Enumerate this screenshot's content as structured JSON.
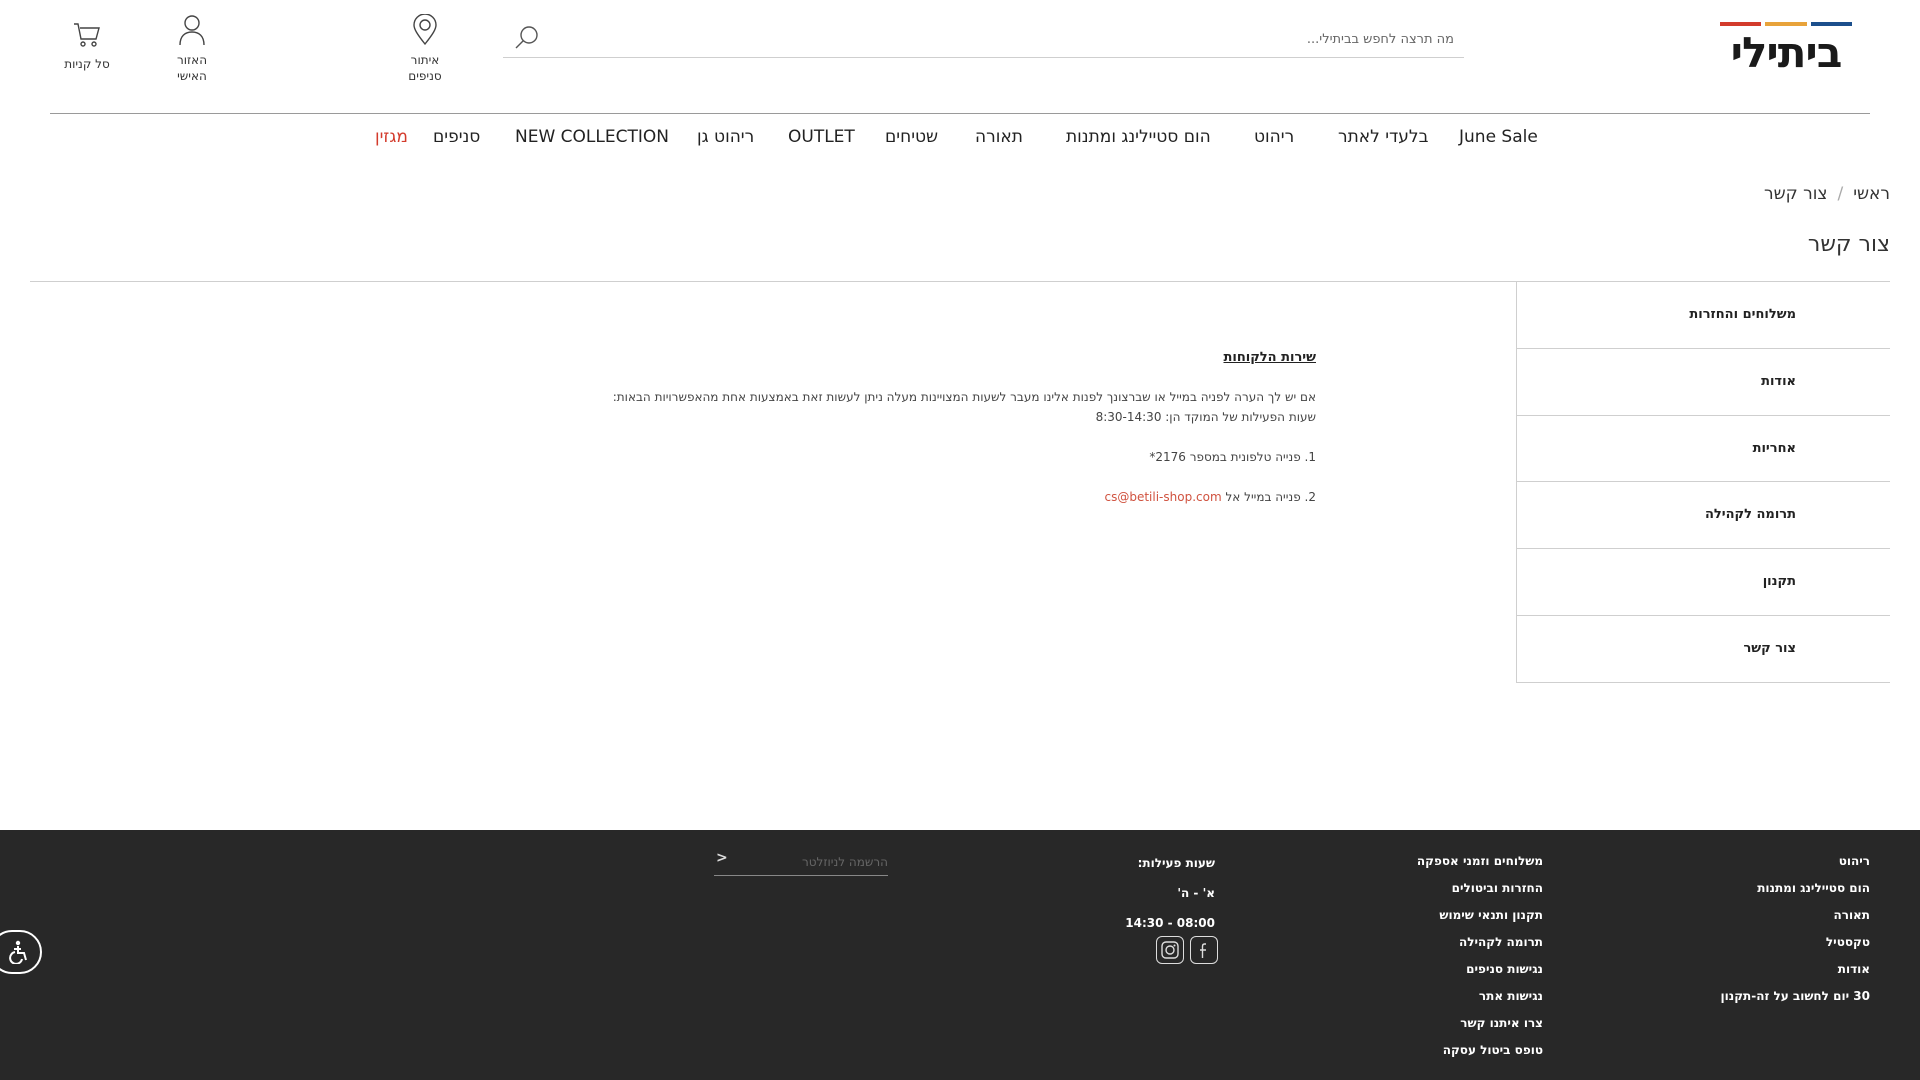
{
  "brand": {
    "logo_text": "ביתילי",
    "bar_colors": [
      "#1c4f8c",
      "#e8a33a",
      "#d33b2c"
    ],
    "accent_color": "#d33b2c"
  },
  "header": {
    "search_placeholder": "מה תרצה לחפש בביתילי...",
    "store_locator_label": "איתור\nסניפים",
    "account_label": "האזור\nהאישי",
    "cart_label": "סל קניות"
  },
  "nav": {
    "items": [
      "June Sale",
      "בלעדי לאתר",
      "ריהוט",
      "הום סטיילינג ומתנות",
      "תאורה",
      "שטיחים",
      "OUTLET",
      "ריהוט גן",
      "NEW COLLECTION",
      "סניפים",
      "מגזין"
    ]
  },
  "breadcrumb": {
    "home": "ראשי",
    "separator": "/",
    "current": "צור קשר"
  },
  "page_title": "צור קשר",
  "sidebar": {
    "items": [
      "משלוחים והחזרות",
      "אודות",
      "אחריות",
      "תרומה לקהילה",
      "תקנון",
      "צור קשר"
    ]
  },
  "content": {
    "heading": "שירות הלקוחות",
    "line1": "אם יש לך הערה לפניה במייל או שברצונך לפנות אלינו מעבר לשעות המצויינות מעלה ניתן לעשות זאת באמצעות אחת מהאפשרויות הבאות:",
    "line2": "שעות הפעילות של המוקד הן: 8:30-14:30",
    "option1": "1. פנייה טלפונית במספר 2176*",
    "option2_prefix": "2. פנייה במייל אל ",
    "email": "cs@betili-shop.com"
  },
  "footer": {
    "col1": [
      "ריהוט",
      "הום סטיילינג ומתנות",
      "תאורה",
      "טקסטיל",
      "אודות",
      "30 יום לחשוב על זה-תקנון"
    ],
    "col2": [
      "משלוחים וזמני אספקה",
      "החזרות וביטולים",
      "תקנון ותנאי שימוש",
      "תרומה לקהילה",
      "נגישות סניפים",
      "נגישות אתר",
      "צרו איתנו קשר",
      "טופס ביטול עסקה"
    ],
    "hours_title": "שעות פעילות:",
    "hours_days": "א' - ה'",
    "hours_time": "08:00 - 14:30",
    "newsletter_placeholder": "הרשמה לניוזלטר",
    "newsletter_submit": ">"
  }
}
